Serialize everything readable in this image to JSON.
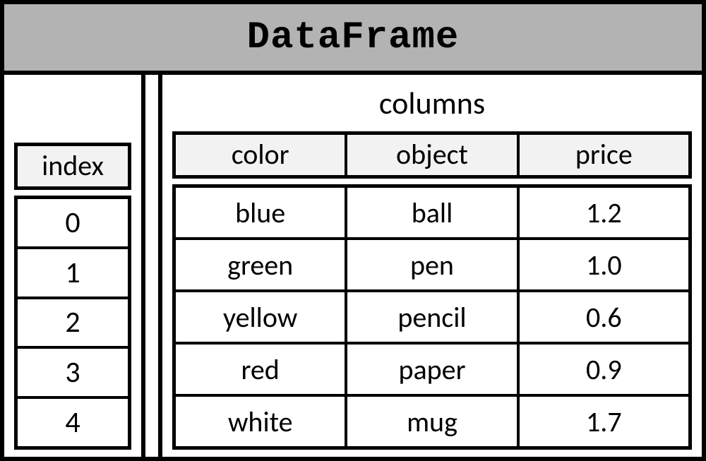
{
  "title": "DataFrame",
  "index_label": "index",
  "columns_label": "columns",
  "chart_data": {
    "type": "table",
    "index": [
      0,
      1,
      2,
      3,
      4
    ],
    "columns": [
      "color",
      "object",
      "price"
    ],
    "rows": [
      {
        "color": "blue",
        "object": "ball",
        "price": 1.2
      },
      {
        "color": "green",
        "object": "pen",
        "price": 1.0
      },
      {
        "color": "yellow",
        "object": "pencil",
        "price": 0.6
      },
      {
        "color": "red",
        "object": "paper",
        "price": 0.9
      },
      {
        "color": "white",
        "object": "mug",
        "price": 1.7
      }
    ]
  }
}
